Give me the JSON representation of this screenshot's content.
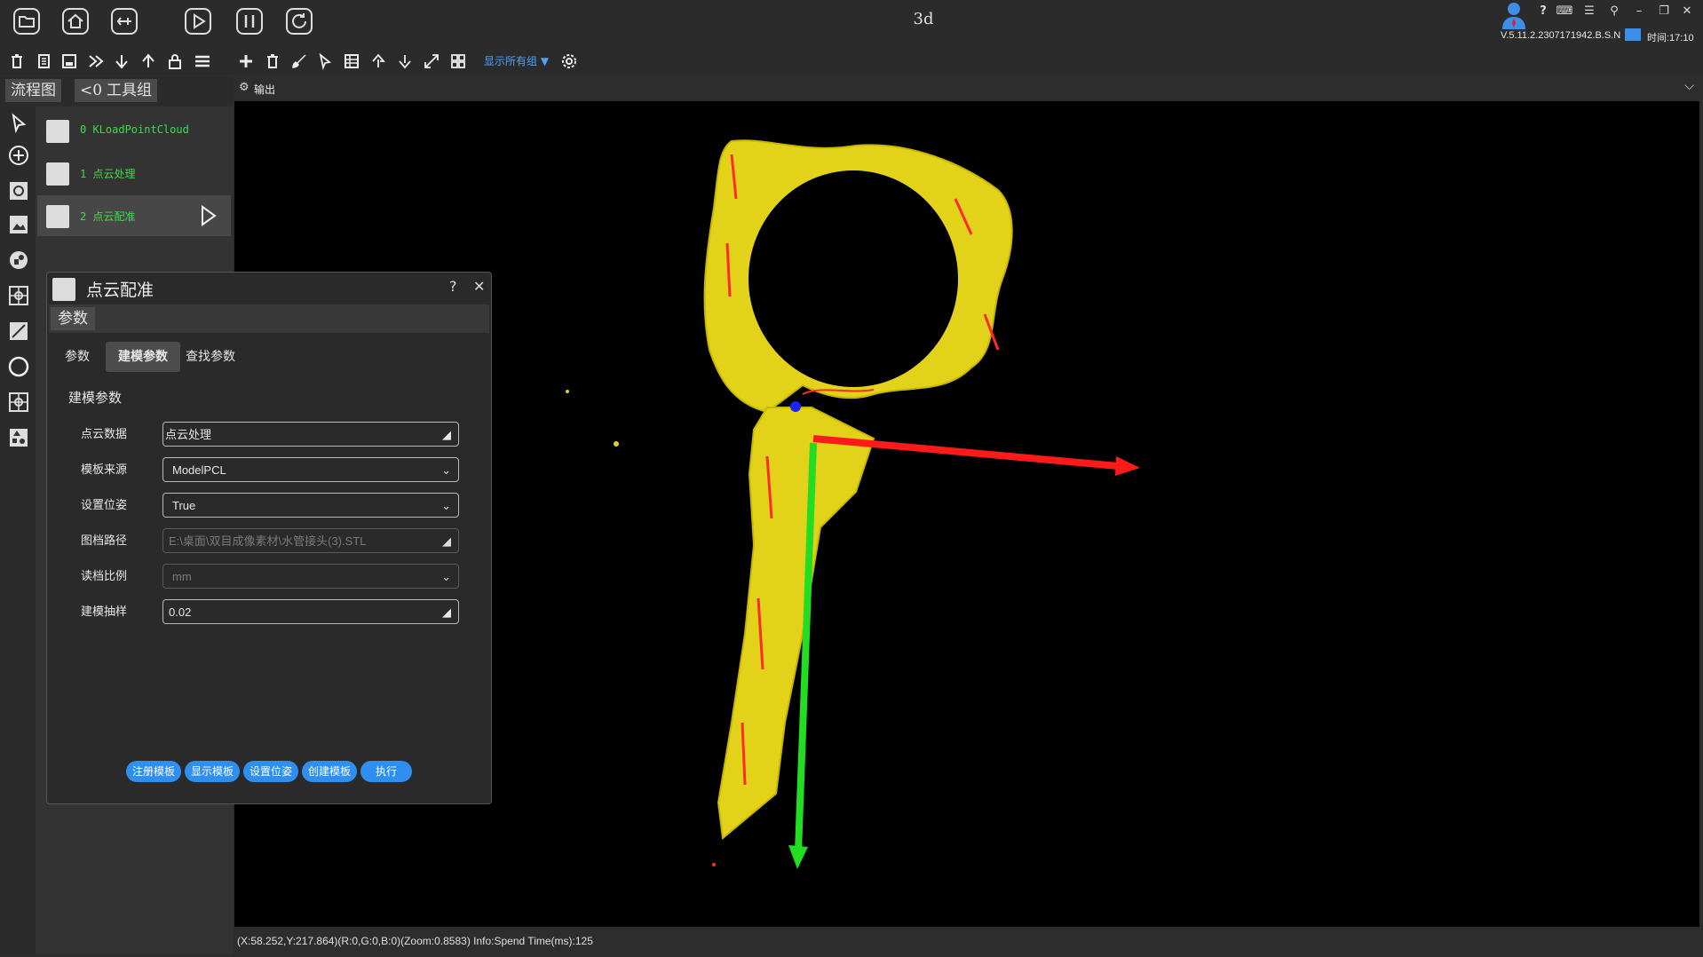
{
  "window": {
    "title": "3d",
    "version": "V.5.11.2.2307171942.B.S.N",
    "time": "时间:17:10"
  },
  "toolbar": {
    "show_all_groups": "显示所有组"
  },
  "left_tabs": {
    "flow": "流程图",
    "tools_count": "<0",
    "tools": "工具组"
  },
  "flow_items": [
    {
      "label": "0 KLoadPointCloud"
    },
    {
      "label": "1 点云处理"
    },
    {
      "label": "2 点云配准"
    }
  ],
  "viewport": {
    "header": "输出",
    "status": "(X:58.252,Y:217.864)(R:0,G:0,B:0)(Zoom:0.8583)   Info:Spend Time(ms):125"
  },
  "dialog": {
    "title": "点云配准",
    "help": "?",
    "close": "✕",
    "params_tab": "参数",
    "subtabs": [
      "参数",
      "建模参数",
      "查找参数"
    ],
    "section_title": "建模参数",
    "rows": [
      {
        "label": "点云数据",
        "value": "点云处理"
      },
      {
        "label": "模板来源",
        "value": "ModelPCL"
      },
      {
        "label": "设置位姿",
        "value": "True"
      },
      {
        "label": "图档路径",
        "value": "E:\\桌面\\双目成像素材\\水管接头(3).STL"
      },
      {
        "label": "读档比例",
        "value": "mm"
      },
      {
        "label": "建模抽样",
        "value": "0.02"
      }
    ],
    "buttons": [
      "注册模板",
      "显示模板",
      "设置位姿",
      "创建模板",
      "执行"
    ]
  },
  "colors": {
    "accent": "#2f8ff0",
    "flow_label": "#3ddc4a",
    "cloud": "#e3d21a",
    "axis_x": "#ff1a1a",
    "axis_y": "#22dd22"
  }
}
